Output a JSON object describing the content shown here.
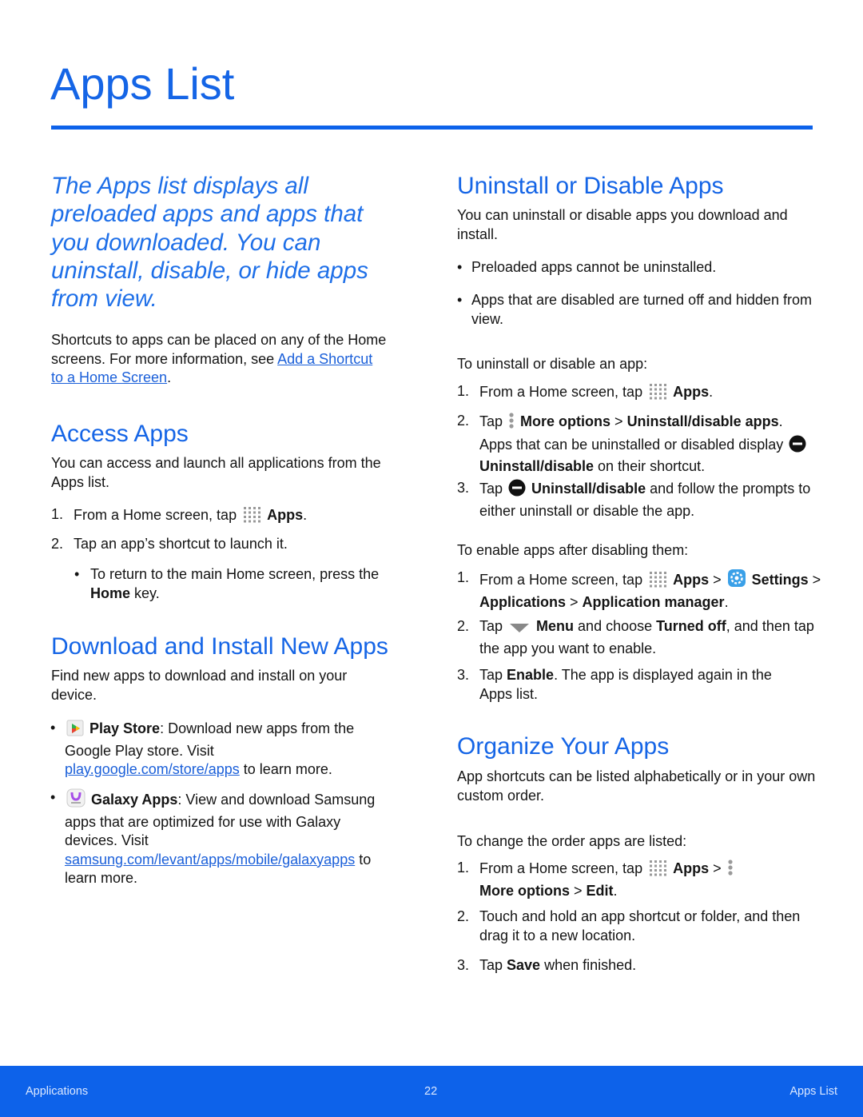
{
  "title": "Apps List",
  "intro": "The Apps list displays all preloaded apps and apps that you downloaded. You can uninstall, disable, or hide apps from view.",
  "colors": {
    "accent": "#1565e6",
    "footer": "#0d62ea",
    "text": "#141414"
  },
  "left": {
    "shortcuts": [
      "Shortcuts to apps can be placed on any of the Home screens. For more information, see ",
      {
        "a": "Add a Shortcut to a Home Screen"
      },
      "."
    ],
    "access": {
      "heading": "Access Apps",
      "para": [
        "You can access and launch all applications from the Apps list."
      ],
      "step1": [
        "From a Home screen, tap ",
        {
          "icon": "apps-grid-icon"
        },
        {
          "b": "Apps"
        },
        "."
      ],
      "step2": [
        "Tap an app’s shortcut to launch it."
      ],
      "sub": [
        "To return to the main Home screen, press the ",
        {
          "b": "Home"
        },
        " key."
      ]
    },
    "download": {
      "heading": "Download and Install New Apps",
      "para": [
        "Find new apps to download and install on your device."
      ],
      "play": [
        {
          "icon": "play-store-icon"
        },
        {
          "b": "Play Store"
        },
        ": Download new apps from the Google Play store. Visit ",
        {
          "a": "play.google.com/store/apps"
        },
        " to learn more."
      ],
      "galaxy": [
        {
          "icon": "galaxy-apps-icon"
        },
        {
          "b": "Galaxy Apps"
        },
        ": View and download Samsung apps that are optimized for use with Galaxy devices. Visit ",
        {
          "a": "samsung.com/levant/apps/mobile/galaxyapps"
        },
        " to learn more."
      ]
    }
  },
  "right": {
    "uninstall": {
      "heading": "Uninstall or Disable Apps",
      "para": [
        "You can uninstall or disable apps you download and install."
      ],
      "b1": [
        "Preloaded apps cannot be uninstalled."
      ],
      "b2": [
        "Apps that are disabled are turned off and hidden from view."
      ],
      "lead1": [
        "To uninstall or disable an app:"
      ],
      "s1": [
        "From a Home screen, tap ",
        {
          "icon": "apps-grid-icon"
        },
        {
          "b": "Apps"
        },
        "."
      ],
      "s2": [
        "Tap ",
        {
          "icon": "more-options-icon"
        },
        {
          "b": "More options"
        },
        " > ",
        {
          "b": "Uninstall/disable apps"
        },
        ". Apps that can be uninstalled or disabled display ",
        {
          "icon": "uninstall-icon"
        },
        {
          "b": "Uninstall/disable"
        },
        " on their shortcut."
      ],
      "s3": [
        "Tap ",
        {
          "icon": "uninstall-icon"
        },
        {
          "b": "Uninstall/disable"
        },
        " and follow the prompts to either uninstall or disable the app."
      ],
      "lead2": [
        "To enable apps after disabling them:"
      ],
      "e1": [
        "From a Home screen, tap ",
        {
          "icon": "apps-grid-icon"
        },
        {
          "b": "Apps"
        },
        " > ",
        {
          "icon": "settings-icon"
        },
        {
          "b": "Settings"
        },
        " > ",
        {
          "b": "Applications"
        },
        " > ",
        {
          "b": "Application manager"
        },
        "."
      ],
      "e2": [
        "Tap ",
        {
          "icon": "menu-dropdown-icon"
        },
        {
          "b": "Menu"
        },
        " and choose ",
        {
          "b": "Turned off"
        },
        ", and then tap the app you want to enable."
      ],
      "e3": [
        "Tap ",
        {
          "b": "Enable"
        },
        ". The app is displayed again in the Apps list."
      ]
    },
    "organize": {
      "heading": "Organize Your Apps",
      "para": [
        "App shortcuts can be listed alphabetically or in your own custom order."
      ],
      "lead": [
        "To change the order apps are listed:"
      ],
      "o1": [
        "From a Home screen, tap ",
        {
          "icon": "apps-grid-icon"
        },
        {
          "b": "Apps"
        },
        " > ",
        {
          "icon": "more-options-icon"
        },
        {
          "b": "More options"
        },
        " > ",
        {
          "b": "Edit"
        },
        "."
      ],
      "o2": [
        "Touch and hold an app shortcut or folder, and then drag it to a new location."
      ],
      "o3": [
        "Tap ",
        {
          "b": "Save"
        },
        " when finished."
      ]
    }
  },
  "list": {
    "n1": "1.",
    "n2": "2.",
    "n3": "3.",
    "bullet": "•"
  },
  "footer": {
    "left": "Applications",
    "page": "22",
    "right": "Apps List"
  }
}
